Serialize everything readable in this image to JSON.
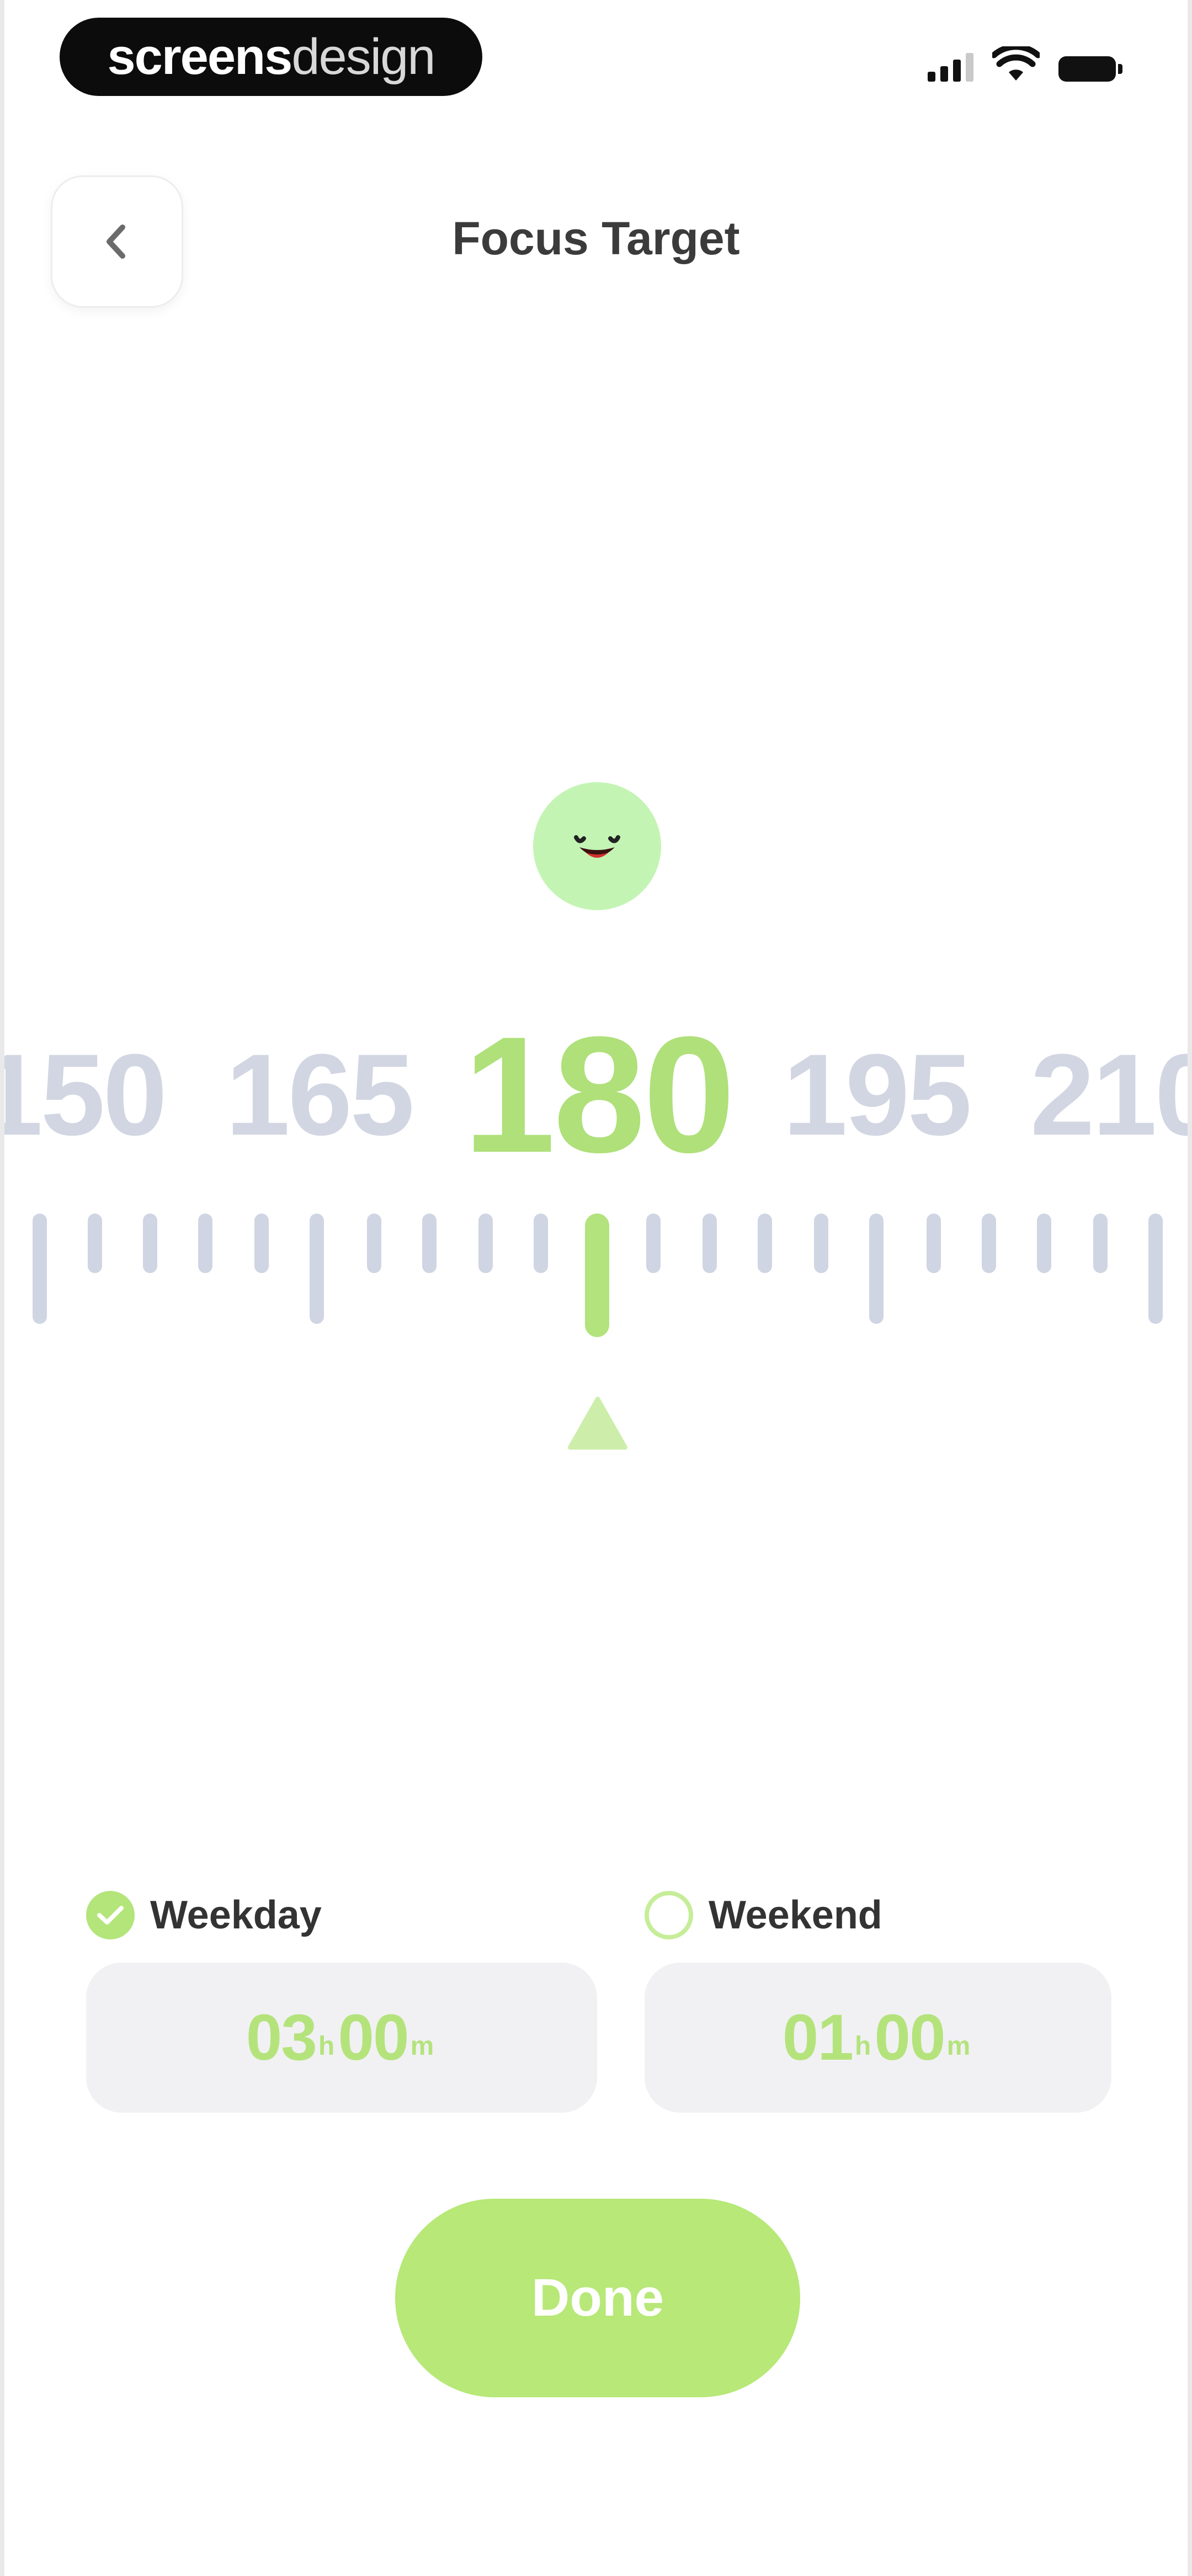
{
  "status_bar": {
    "watermark_bold": "screens",
    "watermark_light": "design"
  },
  "header": {
    "title": "Focus Target",
    "back_icon": "chevron-left-icon"
  },
  "mascot": {
    "icon": "smiling-face-icon",
    "color": "#c4f4b4"
  },
  "ruler": {
    "selected_value": 180,
    "labels": [
      "150",
      "165",
      "180",
      "195",
      "210"
    ],
    "active_color": "#afe07a",
    "inactive_color": "#d2d6e2"
  },
  "options": {
    "weekday": {
      "label": "Weekday",
      "selected": true,
      "hours": "03",
      "hours_unit": "h",
      "minutes": "00",
      "minutes_unit": "m"
    },
    "weekend": {
      "label": "Weekend",
      "selected": false,
      "hours": "01",
      "hours_unit": "h",
      "minutes": "00",
      "minutes_unit": "m"
    }
  },
  "done_button": {
    "label": "Done",
    "color": "#b7e878"
  }
}
